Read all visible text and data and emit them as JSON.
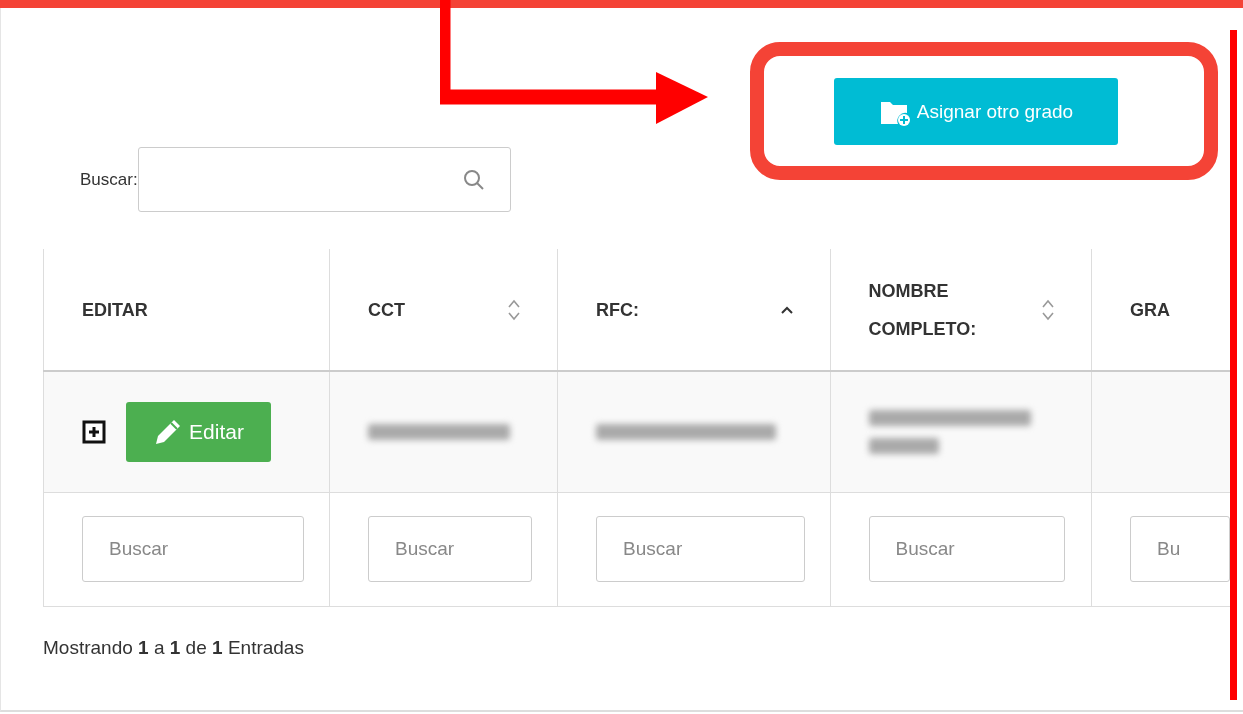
{
  "assign_button": {
    "label": "Asignar otro grado"
  },
  "search": {
    "label": "Buscar:"
  },
  "table": {
    "columns": [
      {
        "label": "EDITAR"
      },
      {
        "label": "CCT",
        "sorted": false
      },
      {
        "label": "RFC:",
        "sorted": true
      },
      {
        "label": "NOMBRE COMPLETO:",
        "sorted": false
      },
      {
        "label": "GRA"
      }
    ],
    "rows": [
      {
        "edit_button": "Editar"
      }
    ],
    "filters": [
      {
        "placeholder": "Buscar"
      },
      {
        "placeholder": "Buscar"
      },
      {
        "placeholder": "Buscar"
      },
      {
        "placeholder": "Buscar"
      },
      {
        "placeholder": "Bu"
      }
    ]
  },
  "footer": "Mostrando **1** a **1** de **1** Entradas"
}
